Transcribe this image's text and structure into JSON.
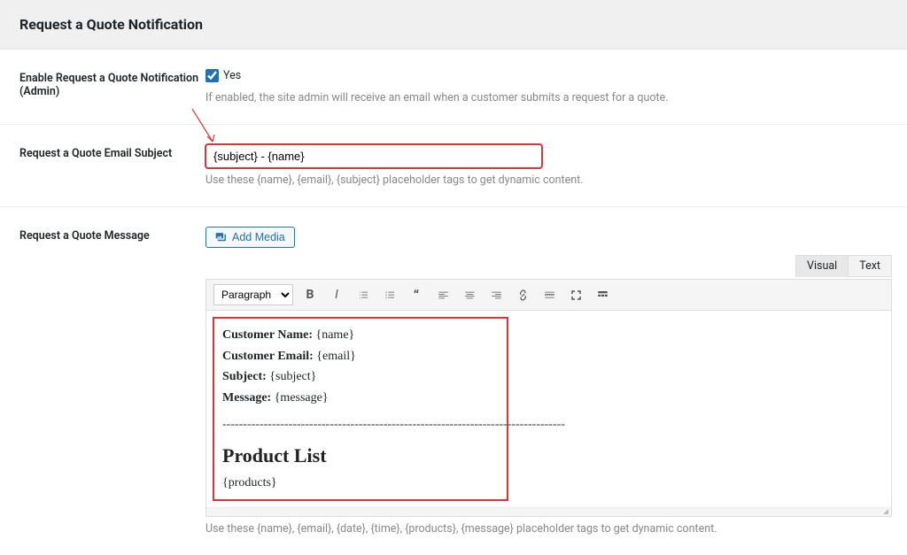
{
  "header": {
    "title": "Request a Quote Notification"
  },
  "enable": {
    "label": "Enable Request a Quote Notification (Admin)",
    "checkbox_label": "Yes",
    "checked": true,
    "help": "If enabled, the site admin will receive an email when a customer submits a request for a quote."
  },
  "subject": {
    "label": "Request a Quote Email Subject",
    "value": "{subject} - {name}",
    "help": "Use these {name}, {email}, {subject} placeholder tags to get dynamic content."
  },
  "message": {
    "label": "Request a Quote Message",
    "add_media": "Add Media",
    "tabs": {
      "visual": "Visual",
      "text": "Text"
    },
    "format_option": "Paragraph",
    "content": {
      "name_label": "Customer Name:",
      "name_val": "{name}",
      "email_label": "Customer Email:",
      "email_val": "{email}",
      "subject_label": "Subject:",
      "subject_val": "{subject}",
      "message_label": "Message:",
      "message_val": "{message}",
      "divider": "-----------------------------------------------------------------------------------",
      "heading": "Product List",
      "products": "{products}"
    },
    "help": "Use these {name}, {email}, {date}, {time}, {products}, {message} placeholder tags to get dynamic content."
  }
}
